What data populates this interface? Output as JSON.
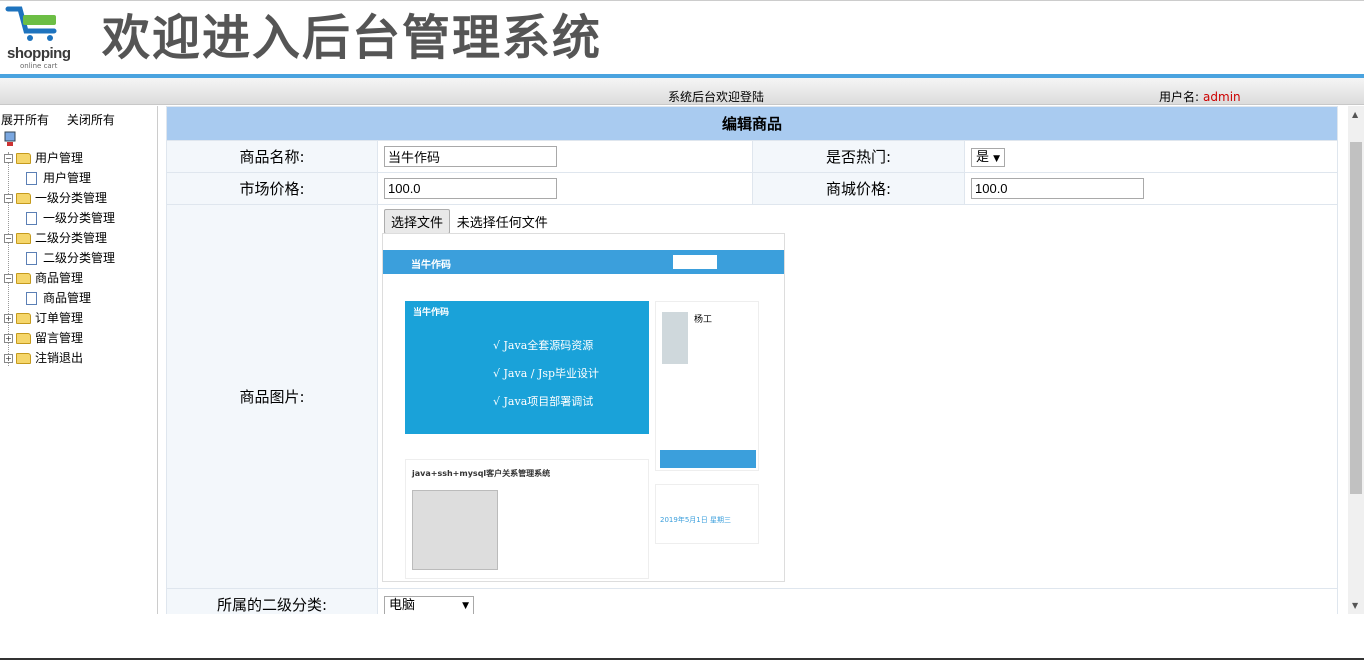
{
  "header": {
    "logo_text": "shopping",
    "logo_subtext": "online cart",
    "title": "欢迎进入后台管理系统"
  },
  "status": {
    "welcome": "系统后台欢迎登陆",
    "user_label": "用户名:",
    "username": "admin"
  },
  "sidebar": {
    "expand_all": "展开所有",
    "collapse_all": "关闭所有",
    "groups": [
      {
        "label": "用户管理",
        "child": "用户管理"
      },
      {
        "label": "一级分类管理",
        "child": "一级分类管理"
      },
      {
        "label": "二级分类管理",
        "child": "二级分类管理"
      },
      {
        "label": "商品管理",
        "child": "商品管理"
      },
      {
        "label": "订单管理"
      },
      {
        "label": "留言管理"
      },
      {
        "label": "注销退出"
      }
    ]
  },
  "form": {
    "heading": "编辑商品",
    "name_label": "商品名称:",
    "name_value": "当牛作码",
    "hot_label": "是否热门:",
    "hot_value": "是",
    "market_price_label": "市场价格:",
    "market_price_value": "100.0",
    "shop_price_label": "商城价格:",
    "shop_price_value": "100.0",
    "image_label": "商品图片:",
    "file_button": "选择文件",
    "file_status": "未选择任何文件",
    "category_label": "所属的二级分类:",
    "category_value": "电脑"
  },
  "preview": {
    "brand": "当牛作码",
    "banner_title": "当牛作码",
    "banner_lines": [
      "√ Java全套源码资源",
      "√ Java / Jsp毕业设计",
      "√ Java项目部署调试"
    ],
    "card_name": "杨工",
    "article_title": "java+ssh+mysql客户关系管理系统",
    "date_text": "2019年5月1日 星期三"
  }
}
